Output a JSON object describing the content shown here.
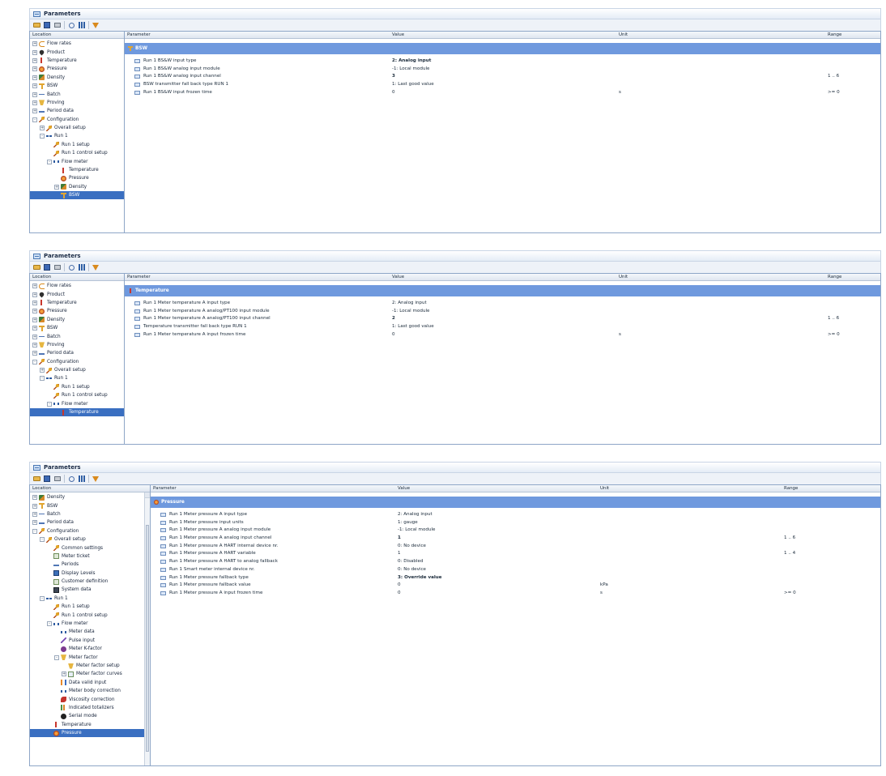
{
  "panels": [
    {
      "title": "Parameters",
      "left_header": "Location",
      "columns": {
        "parameter": "Parameter",
        "value": "Value",
        "unit": "Unit",
        "range": "Range"
      },
      "tree": [
        {
          "label": "Flow rates",
          "icon": "flow-rates-icon",
          "level": 0,
          "expander": "+"
        },
        {
          "label": "Product",
          "icon": "product-icon",
          "level": 0,
          "expander": "+"
        },
        {
          "label": "Temperature",
          "icon": "thermometer-icon",
          "level": 0,
          "expander": "+"
        },
        {
          "label": "Pressure",
          "icon": "pressure-gauge-icon",
          "level": 0,
          "expander": "+"
        },
        {
          "label": "Density",
          "icon": "density-icon",
          "level": 0,
          "expander": "+"
        },
        {
          "label": "BSW",
          "icon": "bsw-icon",
          "level": 0,
          "expander": "+"
        },
        {
          "label": "Batch",
          "icon": "batch-icon",
          "level": 0,
          "expander": "+"
        },
        {
          "label": "Proving",
          "icon": "proving-icon",
          "level": 0,
          "expander": "+"
        },
        {
          "label": "Period data",
          "icon": "period-data-icon",
          "level": 0,
          "expander": "+"
        },
        {
          "label": "Configuration",
          "icon": "configuration-icon",
          "level": 0,
          "expander": "-"
        },
        {
          "label": "Overall setup",
          "icon": "configuration-icon",
          "level": 1,
          "expander": "+"
        },
        {
          "label": "Run 1",
          "icon": "run-icon",
          "level": 1,
          "expander": "-"
        },
        {
          "label": "Run 1 setup",
          "icon": "configuration-icon",
          "level": 2,
          "expander": ""
        },
        {
          "label": "Run 1 control setup",
          "icon": "configuration-icon",
          "level": 2,
          "expander": ""
        },
        {
          "label": "Flow meter",
          "icon": "flow-meter-icon",
          "level": 2,
          "expander": "-"
        },
        {
          "label": "Temperature",
          "icon": "thermometer-icon",
          "level": 3,
          "expander": ""
        },
        {
          "label": "Pressure",
          "icon": "pressure-gauge-icon",
          "level": 3,
          "expander": ""
        },
        {
          "label": "Density",
          "icon": "density-icon",
          "level": 3,
          "expander": "+"
        },
        {
          "label": "BSW",
          "icon": "bsw-icon",
          "level": 3,
          "expander": "",
          "selected": true
        }
      ],
      "group": "BSW",
      "group_icon": "bsw-icon",
      "rows": [
        {
          "parameter": "Run 1 BS&W input type",
          "value": "2: Analog input",
          "unit": "",
          "range": "",
          "bold": true
        },
        {
          "parameter": "Run 1 BS&W analog input module",
          "value": "-1: Local module",
          "unit": "",
          "range": ""
        },
        {
          "parameter": "Run 1 BS&W analog input channel",
          "value": "3",
          "unit": "",
          "range": "1 .. 6",
          "bold": true
        },
        {
          "parameter": "BSW transmitter fall back type RUN 1",
          "value": "1: Last good value",
          "unit": "",
          "range": ""
        },
        {
          "parameter": "Run 1 BS&W input frozen time",
          "value": "0",
          "unit": "s",
          "range": ">= 0"
        }
      ]
    },
    {
      "title": "Parameters",
      "left_header": "Location",
      "columns": {
        "parameter": "Parameter",
        "value": "Value",
        "unit": "Unit",
        "range": "Range"
      },
      "tree": [
        {
          "label": "Flow rates",
          "icon": "flow-rates-icon",
          "level": 0,
          "expander": "+"
        },
        {
          "label": "Product",
          "icon": "product-icon",
          "level": 0,
          "expander": "+"
        },
        {
          "label": "Temperature",
          "icon": "thermometer-icon",
          "level": 0,
          "expander": "+"
        },
        {
          "label": "Pressure",
          "icon": "pressure-gauge-icon",
          "level": 0,
          "expander": "+"
        },
        {
          "label": "Density",
          "icon": "density-icon",
          "level": 0,
          "expander": "+"
        },
        {
          "label": "BSW",
          "icon": "bsw-icon",
          "level": 0,
          "expander": "+"
        },
        {
          "label": "Batch",
          "icon": "batch-icon",
          "level": 0,
          "expander": "+"
        },
        {
          "label": "Proving",
          "icon": "proving-icon",
          "level": 0,
          "expander": "+"
        },
        {
          "label": "Period data",
          "icon": "period-data-icon",
          "level": 0,
          "expander": "+"
        },
        {
          "label": "Configuration",
          "icon": "configuration-icon",
          "level": 0,
          "expander": "-"
        },
        {
          "label": "Overall setup",
          "icon": "configuration-icon",
          "level": 1,
          "expander": "+"
        },
        {
          "label": "Run 1",
          "icon": "run-icon",
          "level": 1,
          "expander": "-"
        },
        {
          "label": "Run 1 setup",
          "icon": "configuration-icon",
          "level": 2,
          "expander": ""
        },
        {
          "label": "Run 1 control setup",
          "icon": "configuration-icon",
          "level": 2,
          "expander": ""
        },
        {
          "label": "Flow meter",
          "icon": "flow-meter-icon",
          "level": 2,
          "expander": "-"
        },
        {
          "label": "Temperature",
          "icon": "thermometer-icon",
          "level": 3,
          "expander": "",
          "selected": true
        }
      ],
      "group": "Temperature",
      "group_icon": "thermometer-icon",
      "rows": [
        {
          "parameter": "Run 1 Meter temperature A input type",
          "value": "2: Analog input",
          "unit": "",
          "range": ""
        },
        {
          "parameter": "Run 1 Meter temperature A analog/PT100 input module",
          "value": "-1: Local module",
          "unit": "",
          "range": ""
        },
        {
          "parameter": "Run 1 Meter temperature A analog/PT100 input channel",
          "value": "2",
          "unit": "",
          "range": "1 .. 6",
          "bold": true
        },
        {
          "parameter": "Temperature transmitter fall back type RUN 1",
          "value": "1: Last good value",
          "unit": "",
          "range": ""
        },
        {
          "parameter": "Run 1 Meter temperature A input frozen time",
          "value": "0",
          "unit": "s",
          "range": ">= 0"
        }
      ]
    },
    {
      "title": "Parameters",
      "left_header": "Location",
      "columns": {
        "parameter": "Parameter",
        "value": "Value",
        "unit": "Unit",
        "range": "Range"
      },
      "tree": [
        {
          "label": "Density",
          "icon": "density-icon",
          "level": 0,
          "expander": "+"
        },
        {
          "label": "BSW",
          "icon": "bsw-icon",
          "level": 0,
          "expander": "+"
        },
        {
          "label": "Batch",
          "icon": "batch-icon",
          "level": 0,
          "expander": "+"
        },
        {
          "label": "Period data",
          "icon": "period-data-icon",
          "level": 0,
          "expander": "+"
        },
        {
          "label": "Configuration",
          "icon": "configuration-icon",
          "level": 0,
          "expander": "-"
        },
        {
          "label": "Overall setup",
          "icon": "configuration-icon",
          "level": 1,
          "expander": "-"
        },
        {
          "label": "Common settings",
          "icon": "configuration-icon",
          "level": 2,
          "expander": ""
        },
        {
          "label": "Meter ticket",
          "icon": "ticket-icon",
          "level": 2,
          "expander": ""
        },
        {
          "label": "Periods",
          "icon": "period-data-icon",
          "level": 2,
          "expander": ""
        },
        {
          "label": "Display Levels",
          "icon": "display-levels-icon",
          "level": 2,
          "expander": ""
        },
        {
          "label": "Customer definition",
          "icon": "ticket-icon",
          "level": 2,
          "expander": ""
        },
        {
          "label": "System data",
          "icon": "system-data-icon",
          "level": 2,
          "expander": ""
        },
        {
          "label": "Run 1",
          "icon": "run-icon",
          "level": 1,
          "expander": "-"
        },
        {
          "label": "Run 1 setup",
          "icon": "configuration-icon",
          "level": 2,
          "expander": ""
        },
        {
          "label": "Run 1 control setup",
          "icon": "configuration-icon",
          "level": 2,
          "expander": ""
        },
        {
          "label": "Flow meter",
          "icon": "flow-meter-icon",
          "level": 2,
          "expander": "-"
        },
        {
          "label": "Meter data",
          "icon": "flow-meter-icon",
          "level": 3,
          "expander": ""
        },
        {
          "label": "Pulse input",
          "icon": "pulse-input-icon",
          "level": 3,
          "expander": ""
        },
        {
          "label": "Meter K-factor",
          "icon": "k-factor-icon",
          "level": 3,
          "expander": ""
        },
        {
          "label": "Meter factor",
          "icon": "proving-icon",
          "level": 3,
          "expander": "-"
        },
        {
          "label": "Meter factor setup",
          "icon": "proving-icon",
          "level": 4,
          "expander": ""
        },
        {
          "label": "Meter factor curves",
          "icon": "meter-factor-curves-icon",
          "level": 4,
          "expander": "+"
        },
        {
          "label": "Data valid input",
          "icon": "data-valid-input-icon",
          "level": 3,
          "expander": ""
        },
        {
          "label": "Meter body correction",
          "icon": "flow-meter-icon",
          "level": 3,
          "expander": ""
        },
        {
          "label": "Viscosity correction",
          "icon": "viscosity-icon",
          "level": 3,
          "expander": ""
        },
        {
          "label": "Indicated totalizers",
          "icon": "totalizers-icon",
          "level": 3,
          "expander": ""
        },
        {
          "label": "Serial mode",
          "icon": "serial-mode-icon",
          "level": 3,
          "expander": ""
        },
        {
          "label": "Temperature",
          "icon": "thermometer-icon",
          "level": 2,
          "expander": ""
        },
        {
          "label": "Pressure",
          "icon": "pressure-gauge-icon",
          "level": 2,
          "expander": "",
          "selected": true
        }
      ],
      "group": "Pressure",
      "group_icon": "pressure-gauge-icon",
      "rows": [
        {
          "parameter": "Run 1 Meter pressure A input type",
          "value": "2: Analog input",
          "unit": "",
          "range": ""
        },
        {
          "parameter": "Run 1 Meter pressure input units",
          "value": "1: gauge",
          "unit": "",
          "range": ""
        },
        {
          "parameter": "Run 1 Meter pressure A analog input module",
          "value": "-1: Local module",
          "unit": "",
          "range": ""
        },
        {
          "parameter": "Run 1 Meter pressure A analog input channel",
          "value": "1",
          "unit": "",
          "range": "1 .. 6",
          "bold": true
        },
        {
          "parameter": "Run 1 Meter pressure A HART internal device nr.",
          "value": "0: No device",
          "unit": "",
          "range": ""
        },
        {
          "parameter": "Run 1 Meter pressure A HART variable",
          "value": "1",
          "unit": "",
          "range": "1 .. 4"
        },
        {
          "parameter": "Run 1 Meter pressure A HART to analog fallback",
          "value": "0: Disabled",
          "unit": "",
          "range": ""
        },
        {
          "parameter": "Run 1 Smart meter internal device nr.",
          "value": "0: No device",
          "unit": "",
          "range": ""
        },
        {
          "parameter": "Run 1 Meter pressure fallback type",
          "value": "3: Override value",
          "unit": "",
          "range": "",
          "bold": true
        },
        {
          "parameter": "Run 1 Meter pressure fallback value",
          "value": "0",
          "unit": "kPa",
          "range": ""
        },
        {
          "parameter": "Run 1 Meter pressure A input frozen time",
          "value": "0",
          "unit": "s",
          "range": ">= 0"
        }
      ]
    }
  ]
}
